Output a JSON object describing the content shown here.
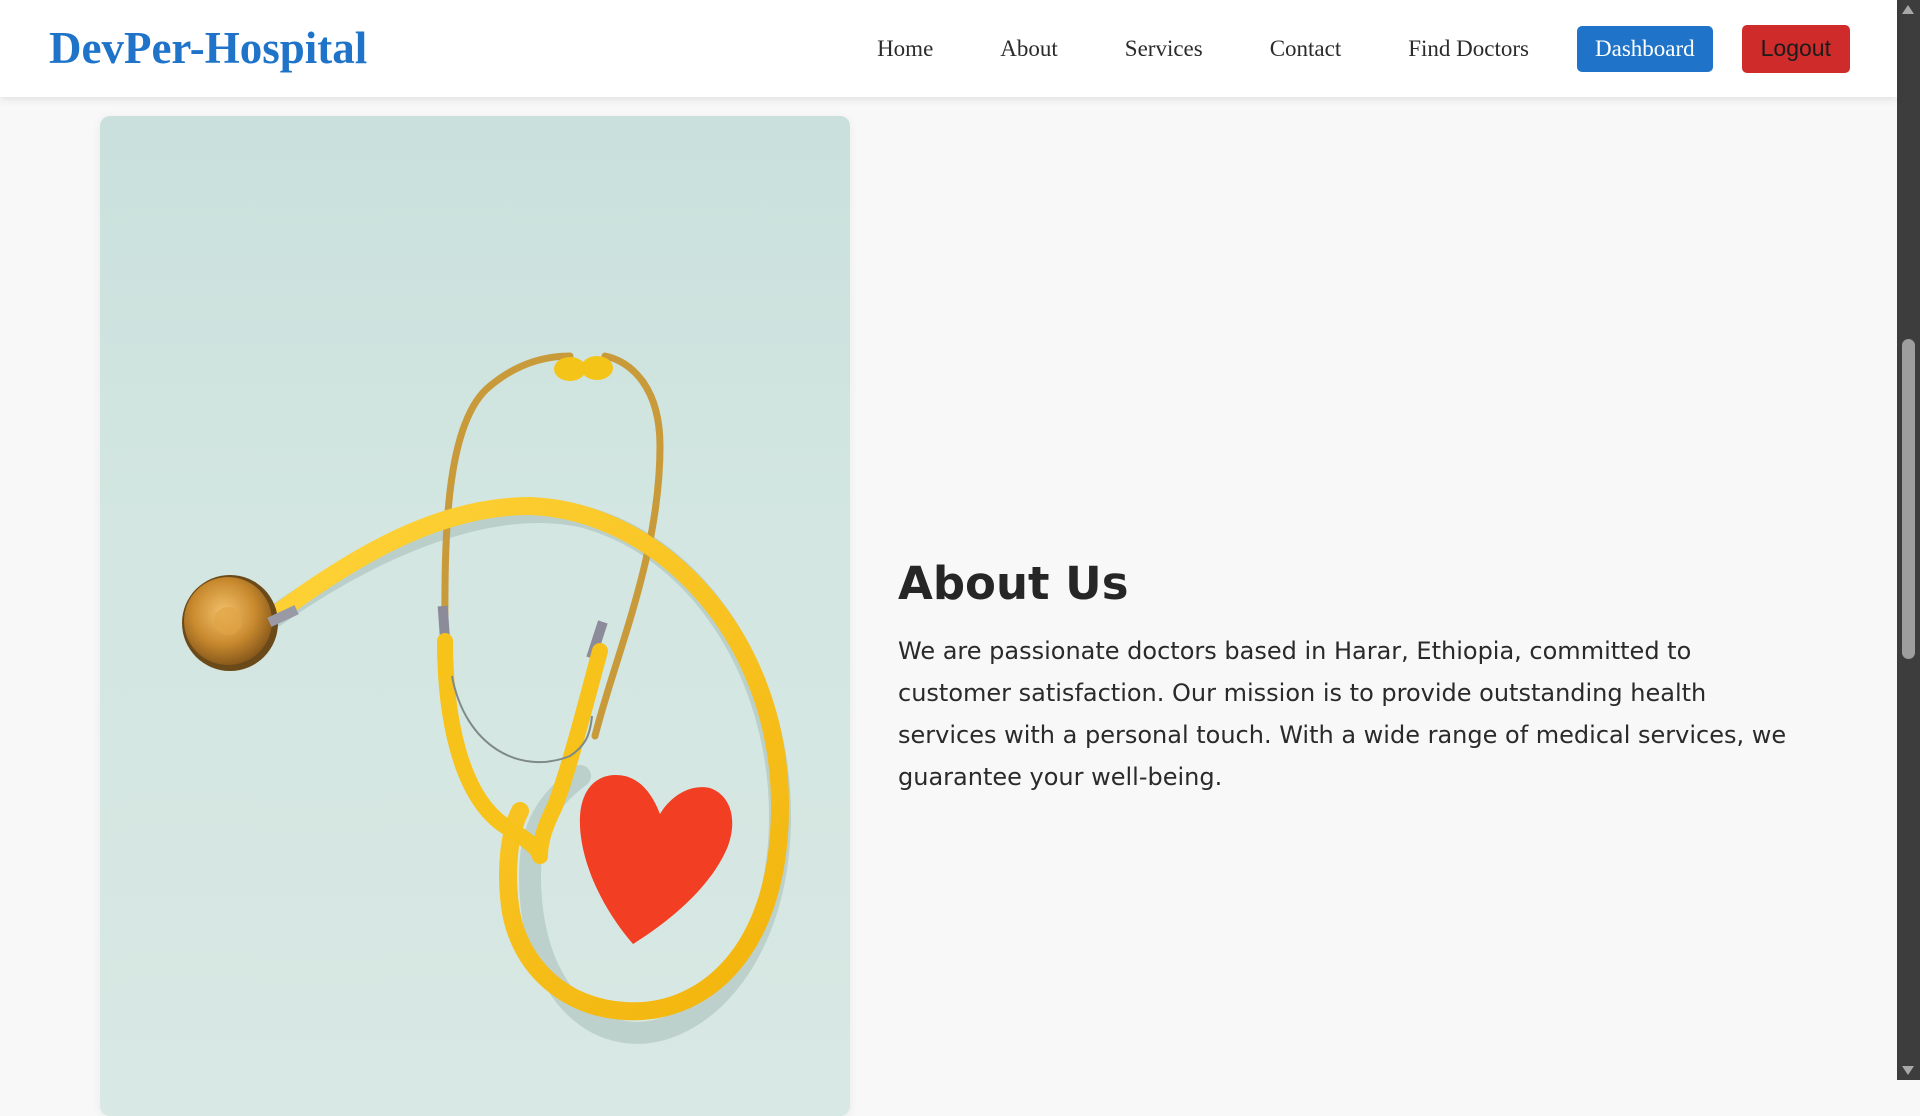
{
  "navbar": {
    "logo": "DevPer-Hospital",
    "links": [
      "Home",
      "About",
      "Services",
      "Contact",
      "Find Doctors"
    ],
    "dashboard_label": "Dashboard",
    "logout_label": "Logout"
  },
  "about": {
    "title": "About Us",
    "paragraph": "We are passionate doctors based in Harar, Ethiopia, committed to customer satisfaction. Our mission is to provide outstanding health services with a personal touch. With a wide range of medical services, we guarantee your well-being."
  },
  "image": {
    "subject_icon": "stethoscope-heart-image"
  },
  "colors": {
    "brand": "#1f74c9",
    "logout": "#cf2b2b",
    "background": "#f8f8f8"
  }
}
